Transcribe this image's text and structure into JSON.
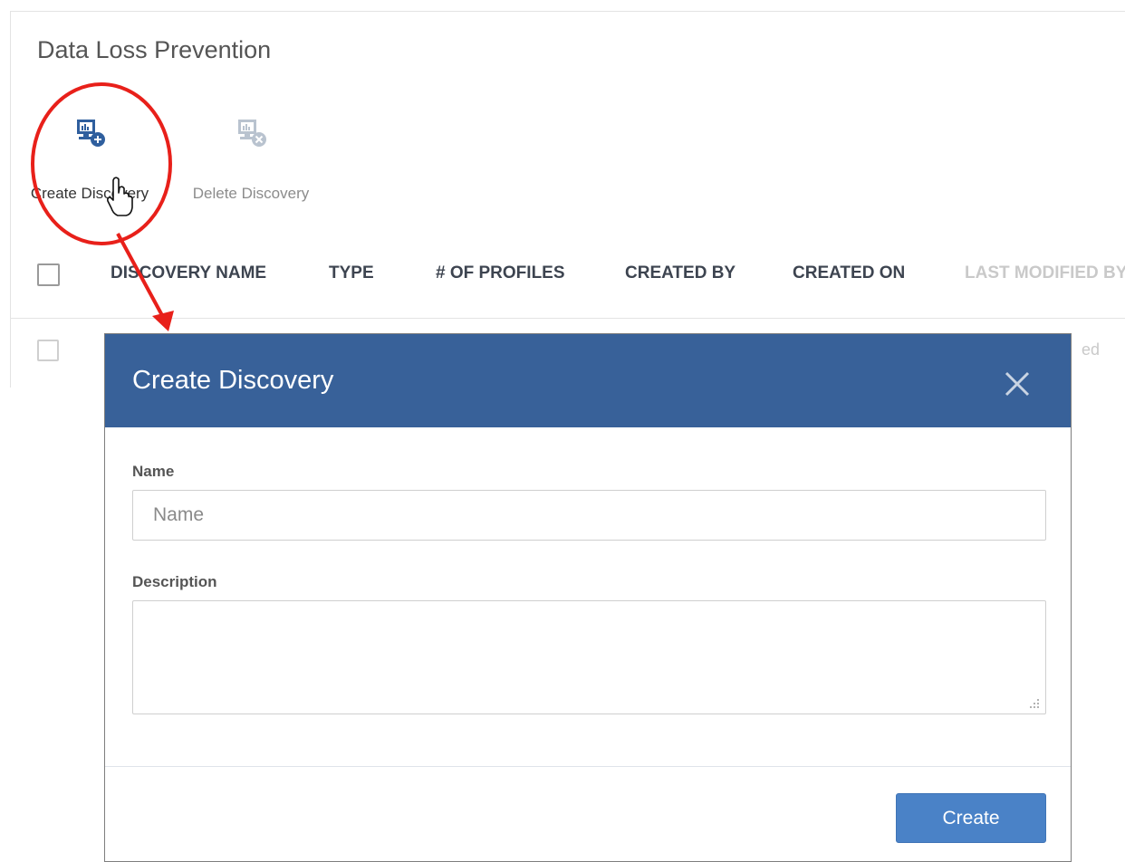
{
  "page": {
    "title": "Data Loss Prevention"
  },
  "toolbar": {
    "create_label": "Create Discovery",
    "delete_label": "Delete Discovery"
  },
  "table": {
    "columns": [
      "DISCOVERY NAME",
      "TYPE",
      "# OF PROFILES",
      "CREATED BY",
      "CREATED ON",
      "LAST MODIFIED BY"
    ],
    "row_tail": "ed"
  },
  "modal": {
    "title": "Create Discovery",
    "name_label": "Name",
    "name_placeholder": "Name",
    "name_value": "",
    "description_label": "Description",
    "description_value": "",
    "submit_label": "Create"
  },
  "colors": {
    "header_bg": "#386199",
    "primary_button": "#4a82c7",
    "annotation": "#e8201a"
  },
  "icons": [
    "monitor-add-icon",
    "monitor-remove-icon",
    "close-icon",
    "hand-cursor-icon",
    "checkbox-icon",
    "resize-grip-icon"
  ]
}
